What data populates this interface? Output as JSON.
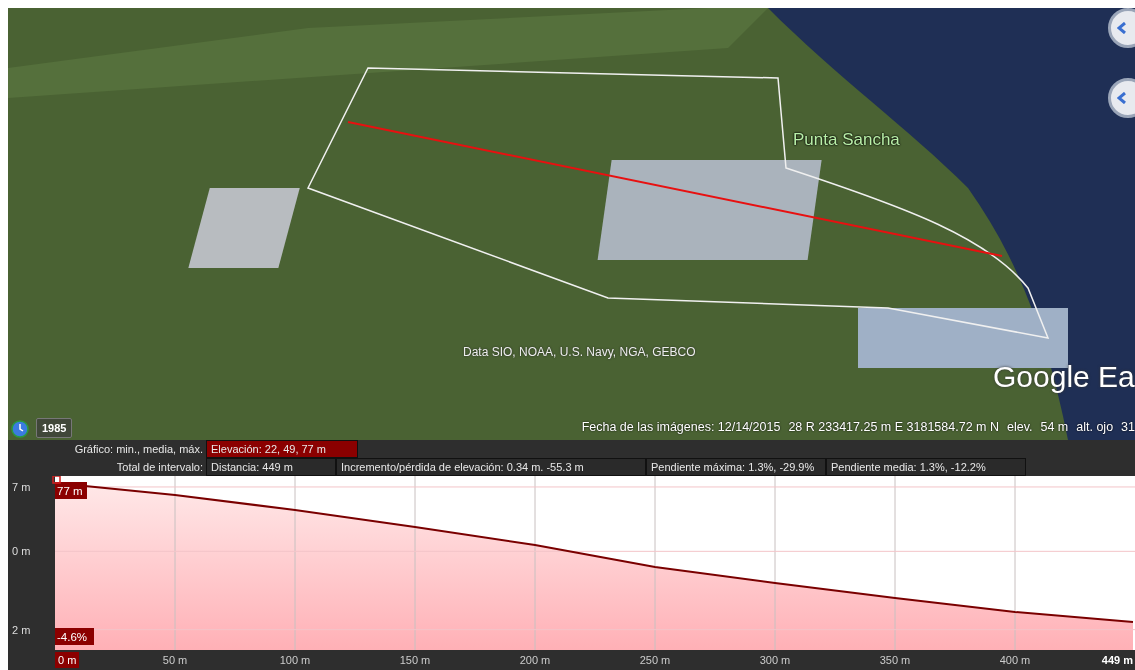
{
  "map": {
    "place_label": "Punta Sancha",
    "attribution": "Data SIO, NOAA, U.S. Navy, NGA, GEBCO",
    "logo": "Google Ea",
    "history_button": "1985",
    "status": [
      {
        "text": "Fecha de las imágenes: 12/14/2015"
      },
      {
        "text": "28 R 233417.25 m E 3181584.72 m N"
      },
      {
        "text": "elev."
      },
      {
        "text": "54 m"
      },
      {
        "text": "alt. ojo"
      },
      {
        "text": "31"
      }
    ]
  },
  "profile": {
    "graph_label": "Gráfico: min., media, máx.",
    "graph_stats": [
      {
        "text": "Elevación: 22, 49, 77 m",
        "selected": true
      }
    ],
    "range_label": "Total de intervalo:",
    "range_stats": [
      {
        "text": "Distancia: 449 m",
        "selected": false
      },
      {
        "text": "Incremento/pérdida de elevación: 0.34 m. -55.3 m",
        "selected": false
      },
      {
        "text": "Pendiente máxima: 1.3%, -29.9%",
        "selected": false
      },
      {
        "text": "Pendiente media: 1.3%, -12.2%",
        "selected": false
      }
    ],
    "x_axis_labels": [
      "0 m",
      "50 m",
      "100 m",
      "150 m",
      "200 m",
      "250 m",
      "300 m",
      "350 m",
      "400 m",
      "449 m"
    ],
    "markers": [
      "77 m",
      "-4.6%"
    ],
    "y_axis_labels": [
      "7 m",
      "0 m",
      "2 m"
    ]
  }
}
